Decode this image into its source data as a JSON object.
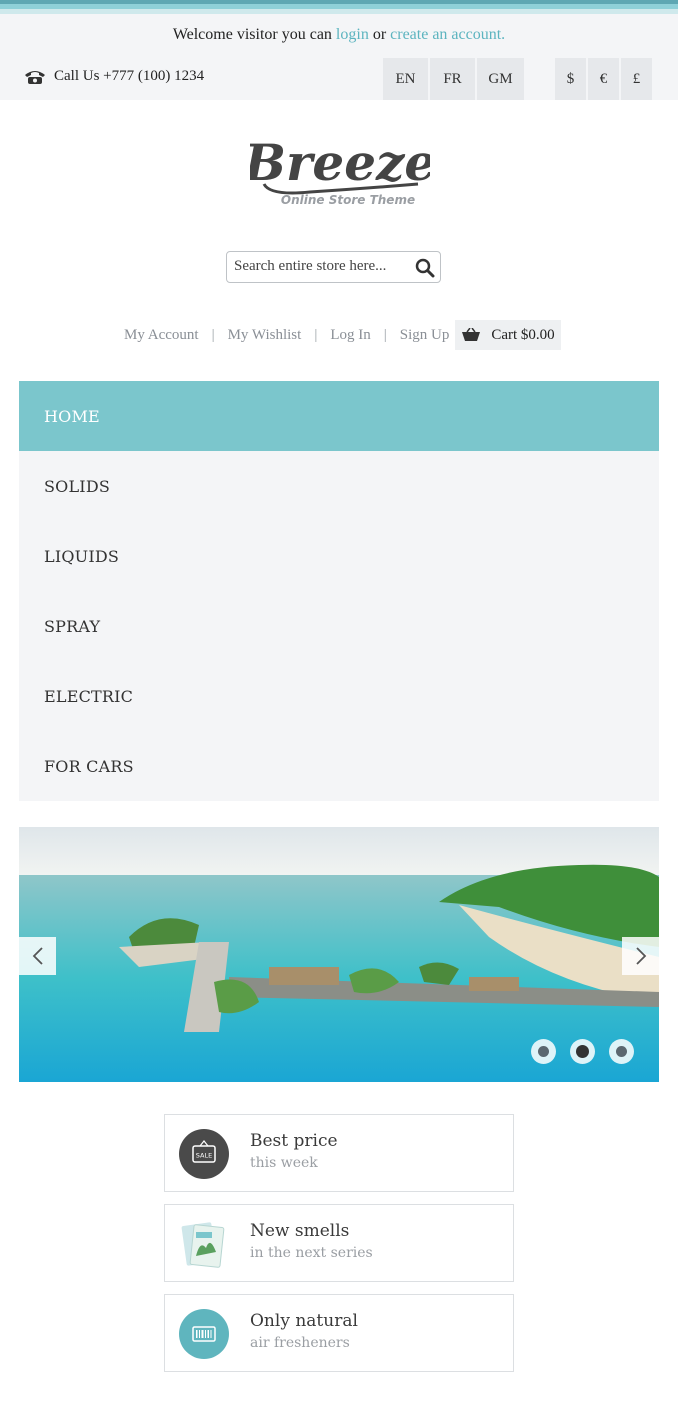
{
  "topbar": {
    "welcome_prefix": "Welcome visitor you can",
    "login_label": "login",
    "or_text": "or",
    "create_account_label": "create an account.",
    "call_text": "Call Us +777 (100) 1234",
    "languages": [
      "EN",
      "FR",
      "GM"
    ],
    "currencies": [
      "$",
      "€",
      "£"
    ]
  },
  "logo": {
    "name": "Breeze",
    "tagline": "Online Store Theme"
  },
  "search": {
    "placeholder": "Search entire store here..."
  },
  "account_links": {
    "my_account": "My Account",
    "my_wishlist": "My Wishlist",
    "log_in": "Log In",
    "sign_up": "Sign Up",
    "separator": "|",
    "cart": "Cart $0.00"
  },
  "nav": {
    "items": [
      "HOME",
      "SOLIDS",
      "LIQUIDS",
      "SPRAY",
      "ELECTRIC",
      "FOR CARS"
    ],
    "active": "HOME"
  },
  "slider": {
    "slide_count": 3,
    "active_index": 1
  },
  "features": [
    {
      "title": "Best price",
      "subtitle": "this week",
      "icon": "sale-tag-icon",
      "sale_label": "SALE"
    },
    {
      "title": "New smells",
      "subtitle": "in the next series",
      "icon": "product-package-icon"
    },
    {
      "title": "Only natural",
      "subtitle": "air fresheners",
      "icon": "barcode-icon"
    }
  ],
  "colors": {
    "accent": "#7bc6cc",
    "link": "#5cb4bf",
    "topbar_bg": "#f4f5f7"
  }
}
